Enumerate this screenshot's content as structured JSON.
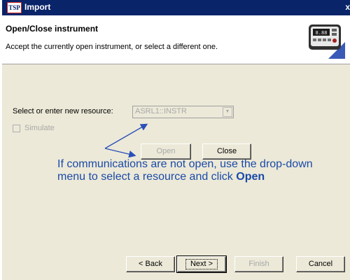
{
  "window": {
    "title": "Import",
    "app_icon_text": "TSP",
    "close_glyph": "x"
  },
  "header": {
    "title": "Open/Close instrument",
    "subtitle": "Accept the currently open instrument, or select a different one."
  },
  "resource": {
    "label": "Select or enter new resource:",
    "value": "ASRL1::INSTR",
    "arrow_glyph": "▼"
  },
  "simulate": {
    "label": "Simulate",
    "checked": false
  },
  "buttons": {
    "open": "Open",
    "close": "Close",
    "back": "< Back",
    "next": "Next >",
    "finish": "Finish",
    "cancel": "Cancel"
  },
  "callout": {
    "text": "If communications are not open, use the drop-down menu to select a resource and click",
    "emphasis": "Open"
  },
  "colors": {
    "titlebar": "#0a246a",
    "dialog_bg": "#ece9d8",
    "callout_text": "#1a4aa8",
    "callout_arrow": "#2a4fb8"
  },
  "icons": {
    "instrument": "instrument-panel-icon",
    "app": "tsp-app-icon"
  }
}
